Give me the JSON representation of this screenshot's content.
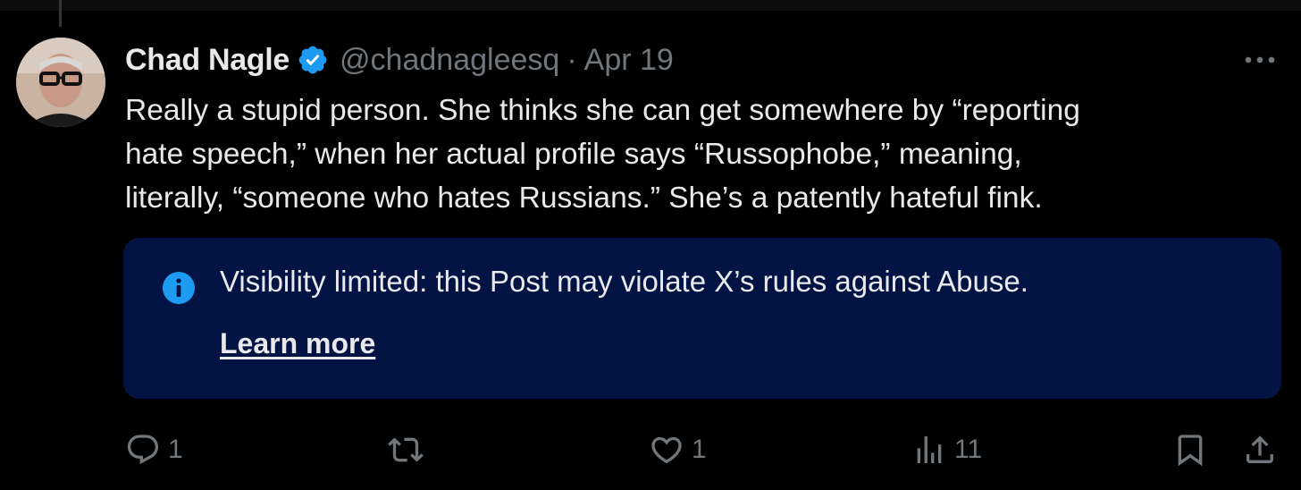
{
  "tweet": {
    "author_name": "Chad Nagle",
    "handle": "@chadnagleesq",
    "separator": "·",
    "date": "Apr 19",
    "text_lines": [
      "Really a stupid person. She thinks she can get somewhere by “reporting",
      "hate speech,” when her actual profile says “Russophobe,” meaning,",
      "literally, “someone who hates Russians.” She’s a patently hateful fink."
    ]
  },
  "notice": {
    "message": "Visibility limited: this Post may violate X’s rules against Abuse.",
    "link_label": "Learn more",
    "background_color": "#031344",
    "icon": "info-icon",
    "icon_color": "#1d9bf0"
  },
  "actions": {
    "reply_count": "1",
    "repost_count": "",
    "like_count": "1",
    "views_count": "11"
  },
  "icons": {
    "verified": "verified-badge-icon",
    "more": "more-icon",
    "reply": "reply-icon",
    "repost": "repost-icon",
    "like": "like-icon",
    "views": "views-icon",
    "bookmark": "bookmark-icon",
    "share": "share-icon"
  },
  "colors": {
    "background": "#000000",
    "text_primary": "#e7e9ea",
    "text_secondary": "#71767b",
    "accent": "#1d9bf0"
  }
}
